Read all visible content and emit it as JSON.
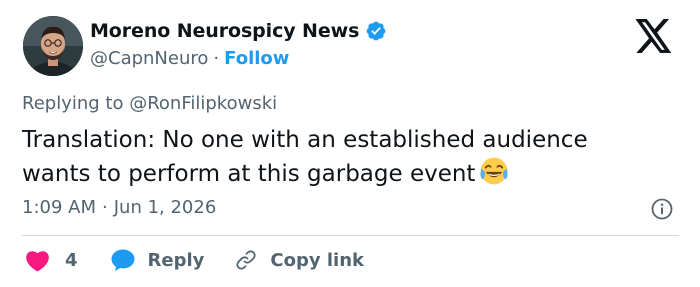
{
  "author": {
    "name": "Moreno Neurospicy News",
    "handle": "@CapnNeuro",
    "separator": "·",
    "follow_label": "Follow",
    "verified": true
  },
  "tweet": {
    "replying_prefix": "Replying to",
    "replying_to": "@RonFilipkowski",
    "text_line1": "Translation: No one with an established audience",
    "text_line2": "wants to perform at this garbage event",
    "emoji": "face-with-tears-of-joy",
    "time": "1:09 AM",
    "meta_separator": "·",
    "date": "Jun 1, 2026"
  },
  "actions": {
    "like_count": "4",
    "reply_label": "Reply",
    "copy_label": "Copy link"
  },
  "colors": {
    "accent": "#1d9bf0",
    "heart": "#f91880",
    "text_primary": "#0f1419",
    "text_secondary": "#536471",
    "divider": "#cfd9de"
  },
  "icons": [
    "avatar",
    "verified-badge-icon",
    "x-logo-icon",
    "info-icon",
    "heart-icon",
    "reply-bubble-icon",
    "link-icon"
  ]
}
